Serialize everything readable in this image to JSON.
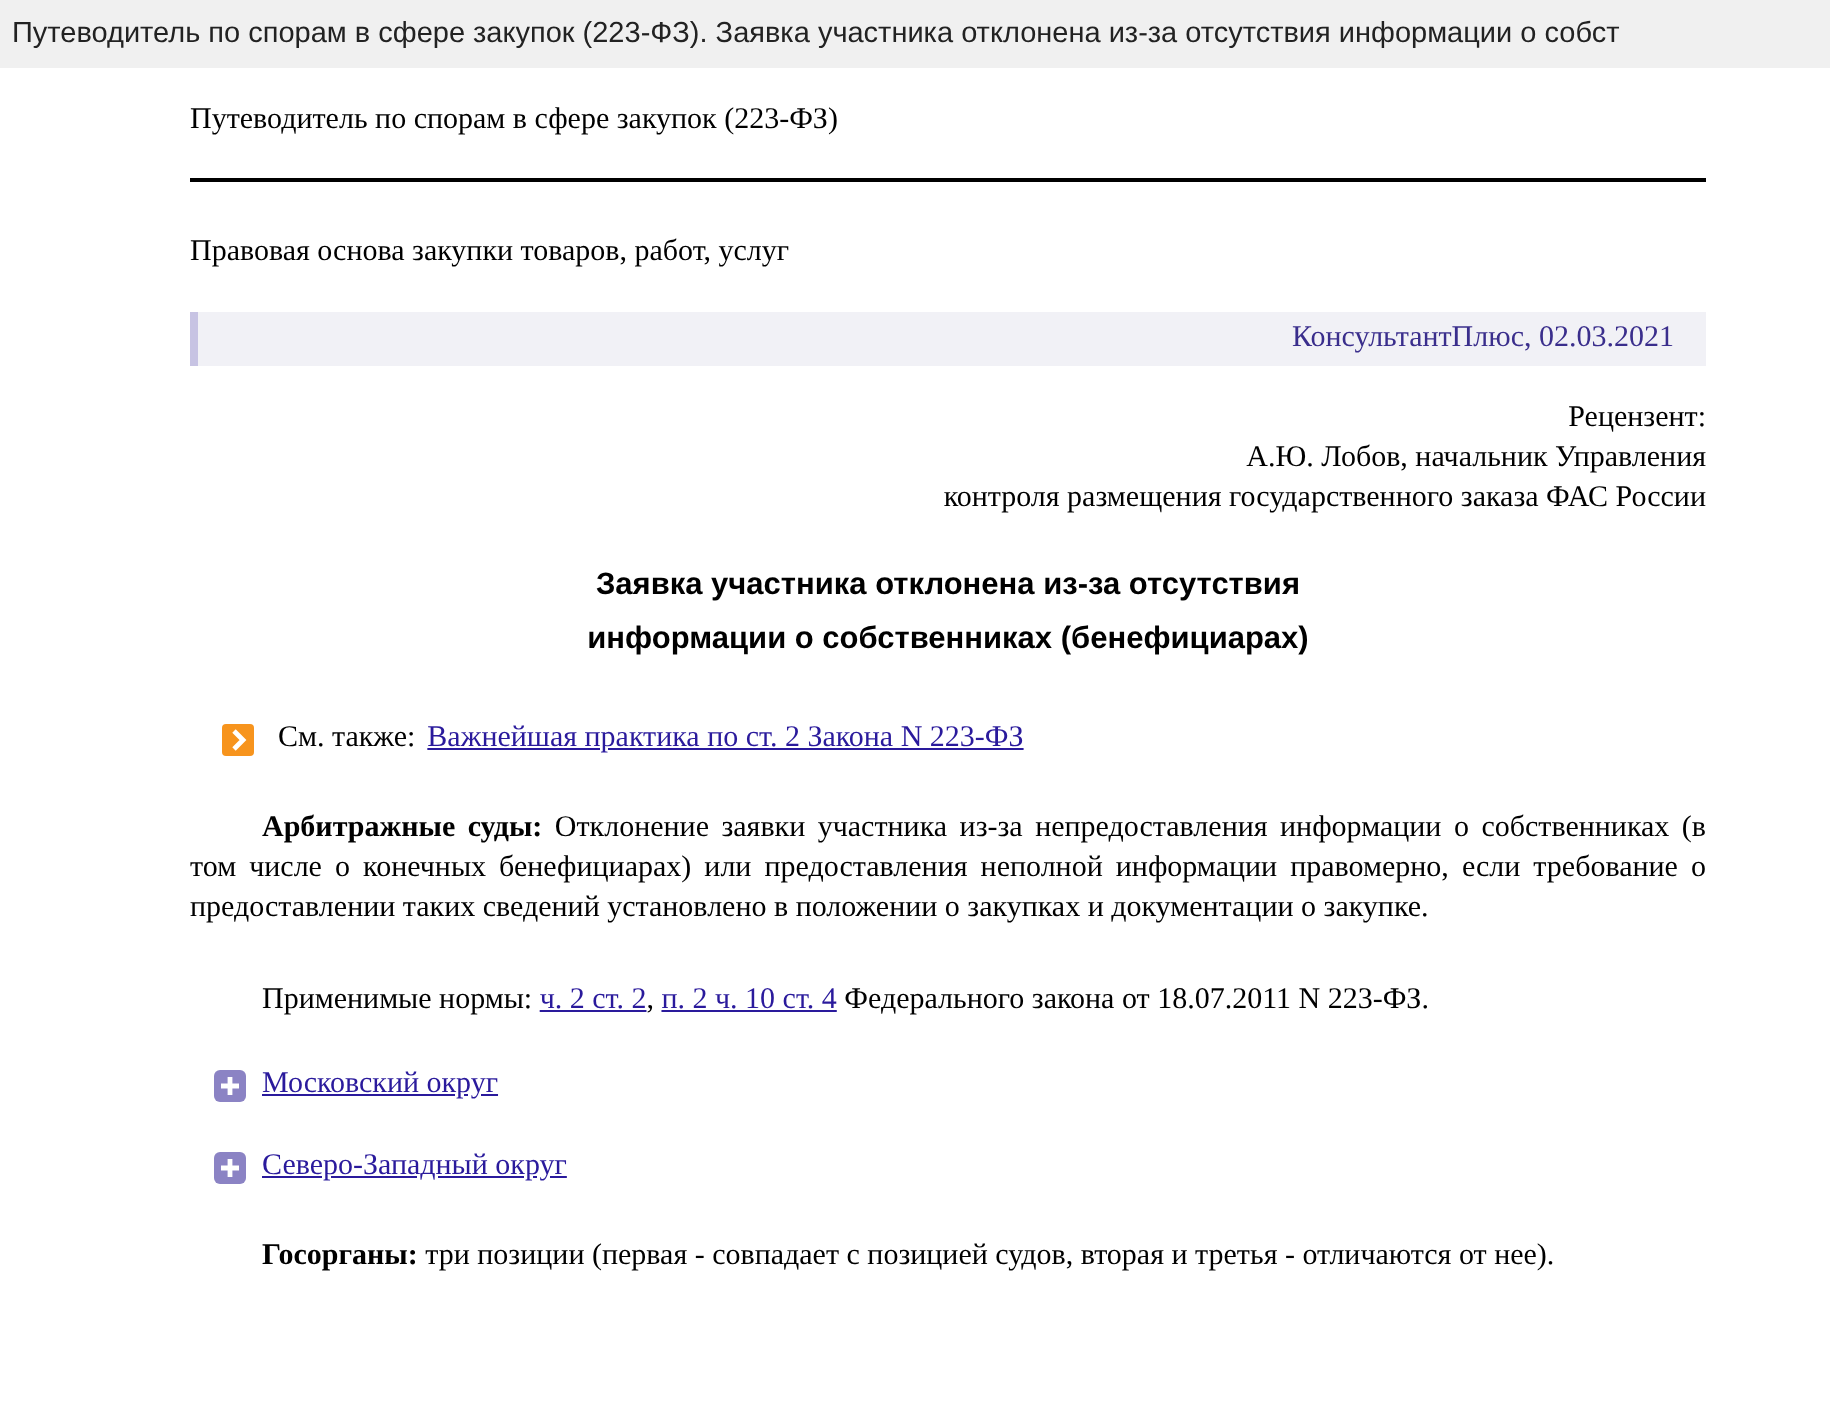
{
  "window": {
    "title": "Путеводитель по спорам в сфере закупок (223-ФЗ). Заявка участника отклонена из-за отсутствия информации о собст"
  },
  "document": {
    "header": "Путеводитель по спорам в сфере закупок (223-ФЗ)",
    "section": "Правовая основа закупки товаров, работ, услуг",
    "source": "КонсультантПлюс, 02.03.2021",
    "reviewer": [
      "Рецензент:",
      "А.Ю. Лобов, начальник Управления",
      "контроля размещения государственного заказа ФАС России"
    ],
    "heading": [
      "Заявка участника отклонена из-за отсутствия",
      "информации о собственниках (бенефициарах)"
    ],
    "see_also": {
      "label": "См. также:",
      "link": "Важнейшая практика по ст. 2 Закона N 223-ФЗ"
    },
    "blocks": [
      {
        "kind": "paragraph",
        "text": "**Арбитражные суды:** Отклонение заявки участника из-за непредоставления информации о собственниках (в том числе о конечных бенефициарах) или предоставления неполной информации правомерно, если требование о предоставлении таких сведений установлено в положении о закупках и документации о закупке."
      },
      {
        "kind": "segments",
        "parts": [
          {
            "kind": "text",
            "text": "Применимые нормы: "
          },
          {
            "kind": "link",
            "text": "ч. 2 ст. 2"
          },
          {
            "kind": "text",
            "text": ", "
          },
          {
            "kind": "link",
            "text": "п. 2 ч. 10 ст. 4"
          },
          {
            "kind": "text",
            "text": " Федерального закона от 18.07.2011 N 223-ФЗ."
          }
        ]
      },
      {
        "kind": "expander",
        "label": "Московский округ",
        "expanded": false
      },
      {
        "kind": "expander",
        "label": "Северо-Западный округ",
        "expanded": false
      },
      {
        "kind": "paragraph",
        "text": "**Госорганы:** три позиции (первая - совпадает с позицией судов, вторая и третья - отличаются от нее)."
      }
    ]
  }
}
